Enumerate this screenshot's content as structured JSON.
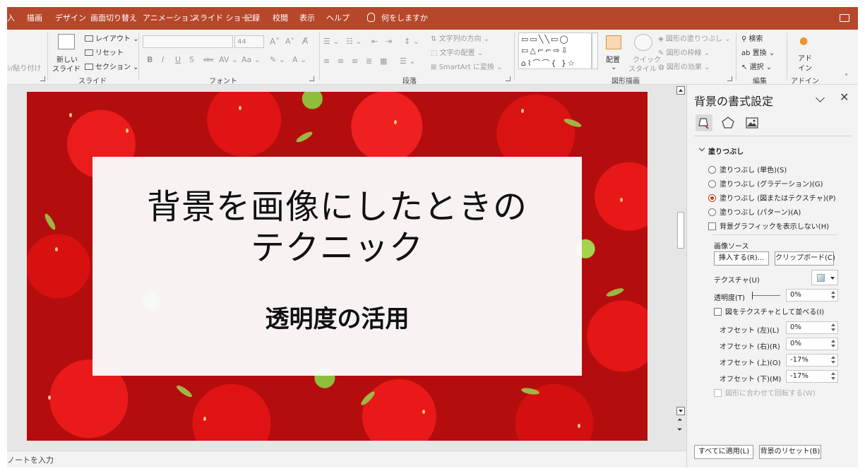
{
  "tabs": [
    "入",
    "描画",
    "デザイン",
    "画面切り替え",
    "アニメーション",
    "スライド ショー",
    "記録",
    "校閲",
    "表示",
    "ヘルプ"
  ],
  "tell_me": "何をしますか",
  "ribbon": {
    "paste_fragment": "ｼ/貼り付け",
    "new_slide_line1": "新しい",
    "new_slide_line2": "スライド",
    "layout": "レイアウト",
    "reset": "リセット",
    "section": "セクション",
    "group_slide": "スライド",
    "font_size": "44",
    "group_font": "フォント",
    "text_direction": "文字列の方向",
    "text_align": "文字の配置",
    "smartart": "SmartArt に変換",
    "group_paragraph": "段落",
    "arrange": "配置",
    "quick_style_line1": "クイック",
    "quick_style_line2": "スタイル",
    "shape_fill": "図形の塗りつぶし",
    "shape_outline": "図形の枠線",
    "shape_effects": "図形の効果",
    "group_drawing": "図形描画",
    "find": "検索",
    "replace": "置換",
    "select": "選択",
    "group_editing": "編集",
    "addin_line1": "アド",
    "addin_line2": "イン",
    "group_addin": "アドイン"
  },
  "slide": {
    "title_line1": "背景を画像にしたときの",
    "title_line2": "テクニック",
    "subtitle": "透明度の活用"
  },
  "notes_placeholder": "ノートを入力",
  "pane": {
    "title": "背景の書式設定",
    "section_fill": "塗りつぶし",
    "fill_options": [
      {
        "label": "塗りつぶし (単色)(S)",
        "selected": false
      },
      {
        "label": "塗りつぶし (グラデーション)(G)",
        "selected": false
      },
      {
        "label": "塗りつぶし (図またはテクスチャ)(P)",
        "selected": true
      },
      {
        "label": "塗りつぶし (パターン)(A)",
        "selected": false
      }
    ],
    "hide_background_graphics": "背景グラフィックを表示しない(H)",
    "image_source": "画像ソース",
    "insert_button": "挿入する(R)...",
    "clipboard_button": "クリップボード(C)",
    "texture_label": "テクスチャ(U)",
    "transparency_label": "透明度(T)",
    "transparency_value": "0%",
    "tile_label": "図をテクスチャとして並べる(I)",
    "offset_left_label": "オフセット (左)(L)",
    "offset_left_value": "0%",
    "offset_right_label": "オフセット (右)(R)",
    "offset_right_value": "0%",
    "offset_top_label": "オフセット (上)(O)",
    "offset_top_value": "-17%",
    "offset_bottom_label": "オフセット (下)(M)",
    "offset_bottom_value": "-17%",
    "rotate_with_shape": "図形に合わせて回転する(W)",
    "apply_all_button": "すべてに適用(L)",
    "reset_bg_button": "背景のリセット(B)"
  },
  "colors": {
    "accent": "#b7472a",
    "radio_selected": "#c43e1c"
  }
}
